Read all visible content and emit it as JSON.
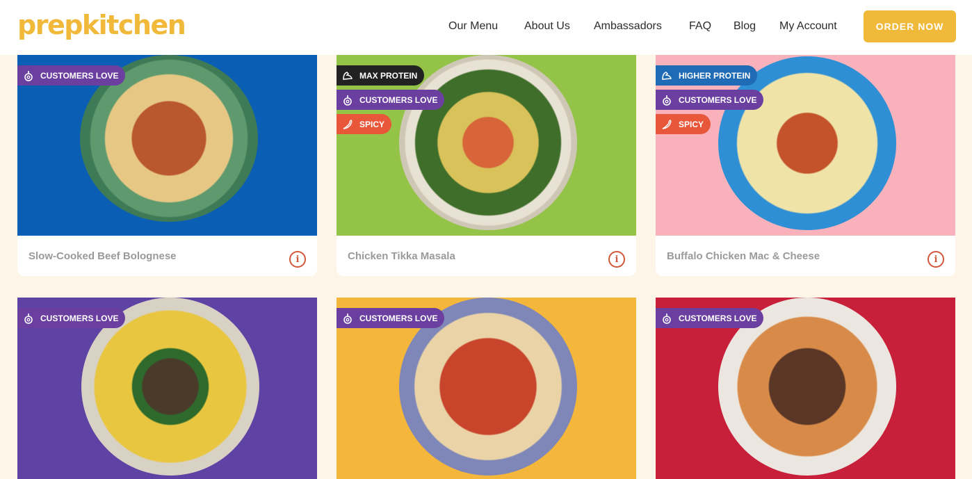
{
  "header": {
    "logo": "prepkitchen",
    "nav": [
      "Our Menu",
      "About Us",
      "Ambassadors",
      "FAQ",
      "Blog",
      "My Account"
    ],
    "order_button": "ORDER NOW"
  },
  "badges": {
    "customers_love": "CUSTOMERS LOVE",
    "max_protein": "MAX PROTEIN",
    "higher_protein": "HIGHER PROTEIN",
    "spicy": "SPICY"
  },
  "cards": [
    {
      "title": "Slow-Cooked Beef Bolognese",
      "bg": "#0a5fb4",
      "badges": [
        "customers_love"
      ]
    },
    {
      "title": "Chicken Tikka Masala",
      "bg": "#94c447",
      "badges": [
        "max_protein",
        "customers_love",
        "spicy"
      ]
    },
    {
      "title": "Buffalo Chicken Mac & Cheese",
      "bg": "#f9b2bc",
      "badges": [
        "higher_protein",
        "customers_love",
        "spicy"
      ]
    },
    {
      "title": "",
      "bg": "#5e43a4",
      "badges": [
        "customers_love"
      ]
    },
    {
      "title": "",
      "bg": "#f4b63b",
      "badges": [
        "customers_love"
      ]
    },
    {
      "title": "",
      "bg": "#c8203a",
      "badges": [
        "customers_love"
      ]
    }
  ],
  "colors": {
    "brand": "#f0b93a",
    "page_bg": "#fdf5e8",
    "info_icon": "#d0573a"
  }
}
